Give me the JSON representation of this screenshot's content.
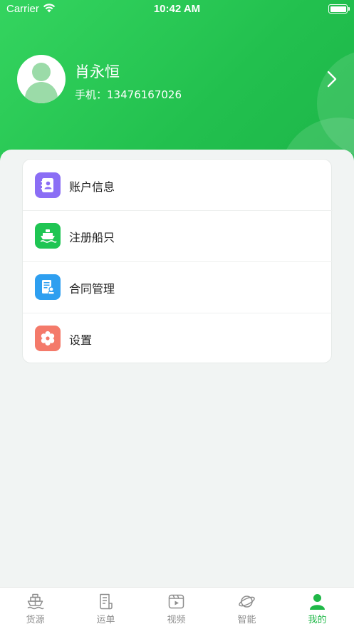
{
  "status_bar": {
    "carrier": "Carrier",
    "time": "10:42 AM"
  },
  "profile": {
    "name": "肖永恒",
    "phone_label": "手机：",
    "phone": "13476167026"
  },
  "menu": {
    "items": [
      {
        "label": "账户信息",
        "icon": "contact-book-icon",
        "color": "#8b6ef5"
      },
      {
        "label": "注册船只",
        "icon": "ship-icon",
        "color": "#1fc553"
      },
      {
        "label": "合同管理",
        "icon": "contract-icon",
        "color": "#2e9ff0"
      },
      {
        "label": "设置",
        "icon": "gear-icon",
        "color": "#f47a6a"
      }
    ]
  },
  "tabbar": {
    "active_color": "#1fb847",
    "tabs": [
      {
        "label": "货源",
        "icon": "cargo-ship-icon",
        "active": false
      },
      {
        "label": "运单",
        "icon": "waybill-icon",
        "active": false
      },
      {
        "label": "视频",
        "icon": "video-icon",
        "active": false
      },
      {
        "label": "智能",
        "icon": "planet-icon",
        "active": false
      },
      {
        "label": "我的",
        "icon": "user-icon",
        "active": true
      }
    ]
  }
}
